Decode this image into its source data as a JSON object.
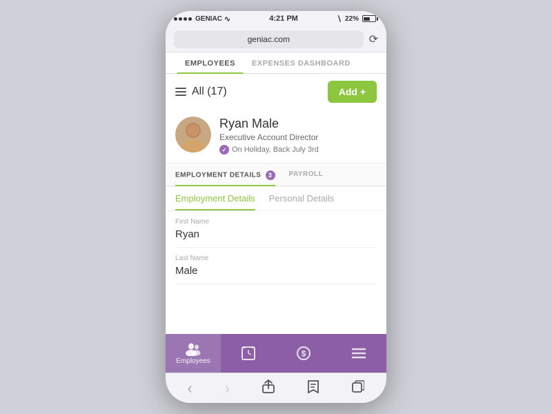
{
  "device": {
    "carrier": "GENIAC",
    "time": "4:21 PM",
    "battery_percent": "22%",
    "url": "geniac.com"
  },
  "top_nav": {
    "tabs": [
      {
        "id": "employees",
        "label": "EMPLOYEES",
        "active": true
      },
      {
        "id": "expenses",
        "label": "EXPENSES DASHBOARD",
        "active": false
      }
    ]
  },
  "list_header": {
    "title": "All (17)",
    "add_button": "Add +"
  },
  "employee": {
    "name": "Ryan Male",
    "title": "Executive Account Director",
    "status": "On Holiday, Back July 3rd"
  },
  "detail_nav": {
    "tabs": [
      {
        "id": "employment",
        "label": "EMPLOYMENT DETAILS",
        "active": true,
        "badge": "3"
      },
      {
        "id": "payroll",
        "label": "PAYROLL",
        "active": false
      }
    ]
  },
  "sub_nav": {
    "tabs": [
      {
        "id": "employment-details",
        "label": "Employment Details",
        "active": true
      },
      {
        "id": "personal-details",
        "label": "Personal Details",
        "active": false
      }
    ]
  },
  "form": {
    "fields": [
      {
        "label": "First Name",
        "value": "Ryan"
      },
      {
        "label": "Last Name",
        "value": "Male"
      }
    ]
  },
  "bottom_nav": {
    "items": [
      {
        "id": "employees",
        "label": "Employees",
        "active": true,
        "icon": "people"
      },
      {
        "id": "timesheet",
        "label": "",
        "active": false,
        "icon": "clock"
      },
      {
        "id": "expenses",
        "label": "",
        "active": false,
        "icon": "dollar"
      },
      {
        "id": "menu",
        "label": "",
        "active": false,
        "icon": "menu"
      }
    ]
  },
  "ios_nav": {
    "back": "‹",
    "forward": "›",
    "share": "⬆",
    "bookmarks": "📖",
    "tabs": "⧉"
  }
}
